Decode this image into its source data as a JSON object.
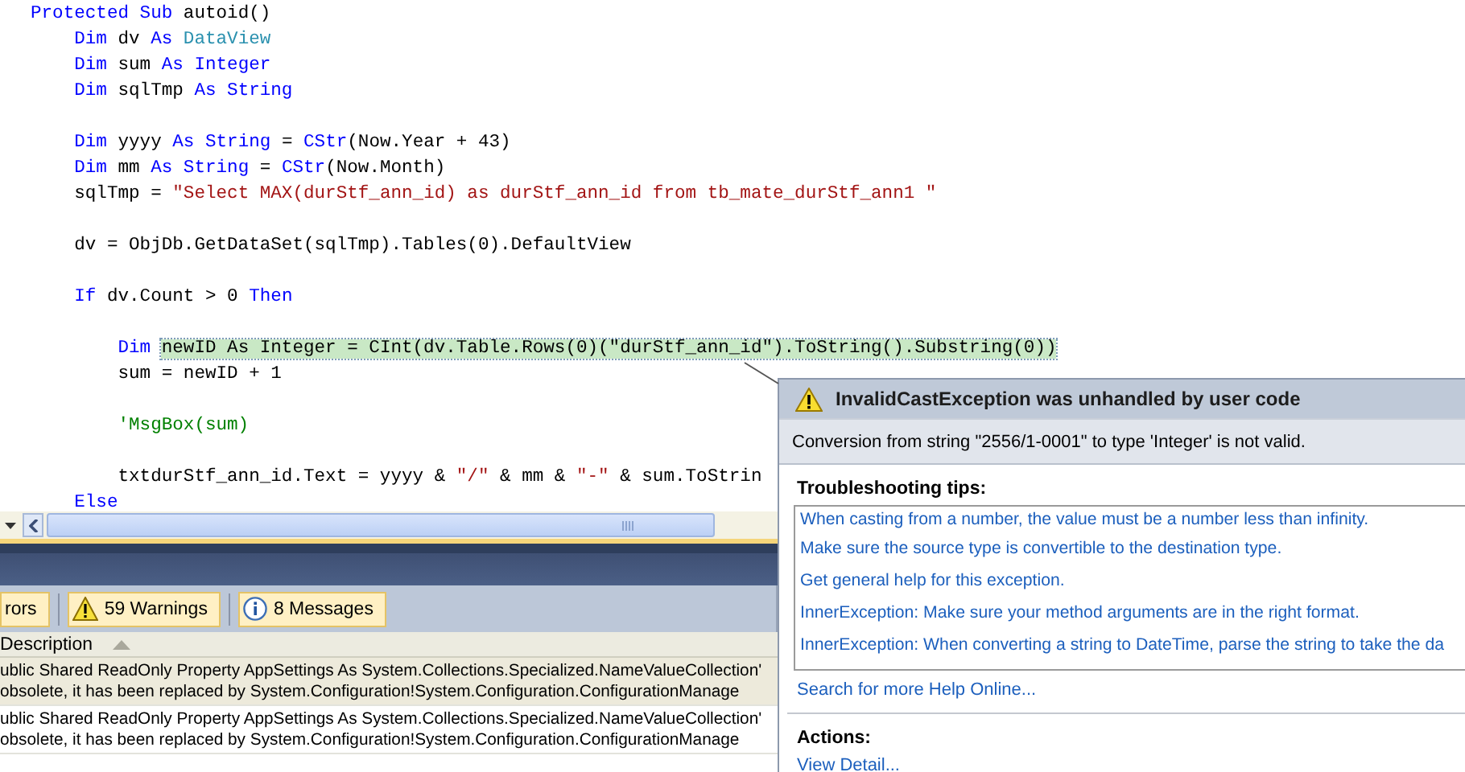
{
  "editor": {
    "lines": [
      {
        "kind": "code",
        "tokens": [
          {
            "kind": "keyword",
            "text": "Protected Sub"
          },
          {
            "kind": "plain",
            "text": " autoid()"
          }
        ]
      },
      {
        "kind": "code",
        "tokens": [
          {
            "kind": "keyword",
            "text": "    Dim"
          },
          {
            "kind": "plain",
            "text": " dv "
          },
          {
            "kind": "keyword",
            "text": "As"
          },
          {
            "kind": "type",
            "text": " DataView"
          }
        ]
      },
      {
        "kind": "code",
        "tokens": [
          {
            "kind": "keyword",
            "text": "    Dim"
          },
          {
            "kind": "plain",
            "text": " sum "
          },
          {
            "kind": "keyword",
            "text": "As Integer"
          }
        ]
      },
      {
        "kind": "code",
        "tokens": [
          {
            "kind": "keyword",
            "text": "    Dim"
          },
          {
            "kind": "plain",
            "text": " sqlTmp "
          },
          {
            "kind": "keyword",
            "text": "As String"
          }
        ]
      },
      {
        "kind": "blank"
      },
      {
        "kind": "code",
        "tokens": [
          {
            "kind": "keyword",
            "text": "    Dim"
          },
          {
            "kind": "plain",
            "text": " yyyy "
          },
          {
            "kind": "keyword",
            "text": "As String"
          },
          {
            "kind": "plain",
            "text": " = "
          },
          {
            "kind": "keyword",
            "text": "CStr"
          },
          {
            "kind": "plain",
            "text": "(Now.Year + 43)"
          }
        ]
      },
      {
        "kind": "code",
        "tokens": [
          {
            "kind": "keyword",
            "text": "    Dim"
          },
          {
            "kind": "plain",
            "text": " mm "
          },
          {
            "kind": "keyword",
            "text": "As String"
          },
          {
            "kind": "plain",
            "text": " = "
          },
          {
            "kind": "keyword",
            "text": "CStr"
          },
          {
            "kind": "plain",
            "text": "(Now.Month)"
          }
        ]
      },
      {
        "kind": "code",
        "tokens": [
          {
            "kind": "plain",
            "text": "    sqlTmp = "
          },
          {
            "kind": "string",
            "text": "\"Select MAX(durStf_ann_id) as durStf_ann_id from tb_mate_durStf_ann1 \""
          }
        ]
      },
      {
        "kind": "blank"
      },
      {
        "kind": "code",
        "tokens": [
          {
            "kind": "plain",
            "text": "    dv = ObjDb.GetDataSet(sqlTmp).Tables(0).DefaultView"
          }
        ]
      },
      {
        "kind": "blank"
      },
      {
        "kind": "code",
        "tokens": [
          {
            "kind": "keyword",
            "text": "    If"
          },
          {
            "kind": "plain",
            "text": " dv.Count > 0 "
          },
          {
            "kind": "keyword",
            "text": "Then"
          }
        ]
      },
      {
        "kind": "blank"
      },
      {
        "kind": "code",
        "tokens": [
          {
            "kind": "keyword",
            "text": "        Dim "
          },
          {
            "kind": "highlight",
            "text": "newID As Integer = CInt(dv.Table.Rows(0)(\"durStf_ann_id\").ToString().Substring(0))"
          }
        ]
      },
      {
        "kind": "code",
        "tokens": [
          {
            "kind": "plain",
            "text": "        sum = newID + 1"
          }
        ]
      },
      {
        "kind": "blank"
      },
      {
        "kind": "code",
        "tokens": [
          {
            "kind": "comment",
            "text": "        'MsgBox(sum)"
          }
        ]
      },
      {
        "kind": "blank"
      },
      {
        "kind": "code",
        "tokens": [
          {
            "kind": "plain",
            "text": "        txtdurStf_ann_id.Text = yyyy & "
          },
          {
            "kind": "string",
            "text": "\"/\""
          },
          {
            "kind": "plain",
            "text": " & mm & "
          },
          {
            "kind": "string",
            "text": "\"-\""
          },
          {
            "kind": "plain",
            "text": " & sum.ToStrin"
          }
        ]
      },
      {
        "kind": "code",
        "tokens": [
          {
            "kind": "keyword",
            "text": "    Else"
          }
        ]
      }
    ]
  },
  "error_list": {
    "filters": [
      {
        "kind": "error",
        "label": "rors",
        "selected": true
      },
      {
        "kind": "warning",
        "label": "59 Warnings",
        "selected": true
      },
      {
        "kind": "message",
        "label": "8 Messages",
        "selected": true
      }
    ],
    "column": "Description",
    "rows": [
      {
        "line_1": "ublic Shared ReadOnly Property AppSettings As System.Collections.Specialized.NameValueCollection'",
        "line_2": "obsolete, it has been replaced by System.Configuration!System.Configuration.ConfigurationManage",
        "selected": true
      },
      {
        "line_1": "ublic Shared ReadOnly Property AppSettings As System.Collections.Specialized.NameValueCollection'",
        "line_2": "obsolete, it has been replaced by System.Configuration!System.Configuration.ConfigurationManage",
        "selected": false
      }
    ]
  },
  "exception": {
    "title": "InvalidCastException was unhandled by user code",
    "message": "Conversion from string \"2556/1-0001\" to type 'Integer' is not valid.",
    "tips_heading": "Troubleshooting tips:",
    "tips": [
      "When casting from a number, the value must be a number less than infinity.",
      "Make sure the source type is convertible to the destination type.",
      "Get general help for this exception.",
      "InnerException: Make sure your method arguments are in the right format.",
      "InnerException: When converting a string to DateTime, parse the string to take the da"
    ],
    "search_link": "Search for more Help Online...",
    "actions_heading": "Actions:",
    "actions": [
      "View Detail..."
    ]
  }
}
